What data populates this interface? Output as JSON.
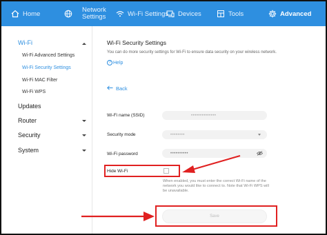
{
  "nav": {
    "home": "Home",
    "network": "Network\nSettings",
    "wifi_settings": "Wi-Fi Settings",
    "devices": "Devices",
    "tools": "Tools",
    "advanced": "Advanced"
  },
  "sidebar": {
    "wifi": "Wi-Fi",
    "wifi_items": [
      "Wi-Fi Advanced Settings",
      "Wi-Fi Security Settings",
      "Wi-Fi MAC Filter",
      "Wi-Fi WPS"
    ],
    "updates": "Updates",
    "router": "Router",
    "security": "Security",
    "system": "System"
  },
  "main": {
    "title": "Wi-Fi Security Settings",
    "description": "You can do more security settings for Wi-Fi to ensure data security on your wireless network.",
    "help": "Help",
    "back": "Back",
    "ssid_label": "Wi-Fi name (SSID)",
    "security_mode_label": "Security mode",
    "password_label": "Wi-Fi password",
    "hide_wifi_label": "Hide Wi-Fi",
    "hide_hint": "When enabled, you must enter the correct Wi-Fi name of the network you would like to connect to. Note that Wi-Fi WPS will be unavailable.",
    "save": "Save"
  },
  "colors": {
    "accent": "#2e8fe0",
    "highlight": "#e02020"
  }
}
